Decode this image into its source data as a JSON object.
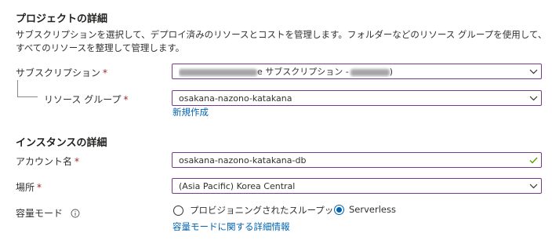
{
  "project": {
    "heading": "プロジェクトの詳細",
    "description": "サブスクリプションを選択して、デプロイ済みのリソースとコストを管理します。フォルダーなどのリソース グループを使用して、すべてのリソースを整理して管理します。",
    "subscription": {
      "label": "サブスクリプション",
      "value_visible": "e サブスクリプション -",
      "value_tail": ")"
    },
    "resource_group": {
      "label": "リソース グループ",
      "value": "osakana-nazono-katakana",
      "create_new_link": "新規作成"
    }
  },
  "instance": {
    "heading": "インスタンスの詳細",
    "account_name": {
      "label": "アカウント名",
      "value": "osakana-nazono-katakana-db",
      "valid": true
    },
    "location": {
      "label": "場所",
      "value": "(Asia Pacific) Korea Central"
    },
    "capacity_mode": {
      "label": "容量モード",
      "options": [
        {
          "label": "プロビジョニングされたスループット",
          "selected": false
        },
        {
          "label": "Serverless",
          "selected": true
        }
      ],
      "learn_more_link": "容量モードに関する詳細情報"
    }
  },
  "required_marker": "*",
  "colors": {
    "field_border": "#7a3a8c",
    "link": "#0063b1",
    "required": "#a4262c",
    "valid_check": "#57a300"
  }
}
